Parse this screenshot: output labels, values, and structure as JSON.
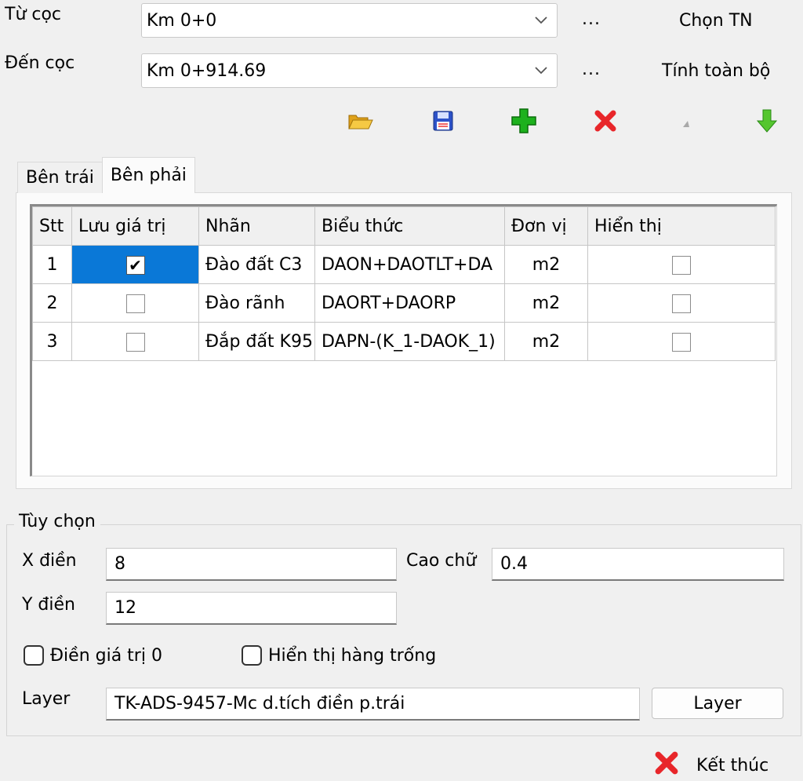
{
  "from_station": {
    "label": "Từ cọc",
    "value": "Km 0+0",
    "more": "...",
    "action": "Chọn TN"
  },
  "to_station": {
    "label": "Đến cọc",
    "value": "Km 0+914.69",
    "more": "...",
    "action": "Tính toàn bộ"
  },
  "toolbar": {
    "icons": [
      "open-folder-icon",
      "save-icon",
      "add-icon",
      "delete-icon",
      "move-up-icon",
      "move-down-icon"
    ]
  },
  "tabs": {
    "left": "Bên trái",
    "right": "Bên phải",
    "active": "right"
  },
  "table": {
    "headers": {
      "stt": "Stt",
      "save": "Lưu giá trị",
      "label": "Nhãn",
      "expr": "Biểu thức",
      "unit": "Đơn vị",
      "display": "Hiển thị"
    },
    "rows": [
      {
        "stt": "1",
        "save": true,
        "label": "Đào đất C3",
        "expr": "DAON+DAOTLT+DA",
        "unit": "m2",
        "display": false
      },
      {
        "stt": "2",
        "save": false,
        "label": "Đào rãnh",
        "expr": "DAORT+DAORP",
        "unit": "m2",
        "display": false
      },
      {
        "stt": "3",
        "save": false,
        "label": "Đắp đất K95",
        "expr": "DAPN-(K_1-DAOK_1)",
        "unit": "m2",
        "display": false
      }
    ]
  },
  "options": {
    "title": "Tùy chọn",
    "x_label": "X điền",
    "x_value": "8",
    "y_label": "Y điền",
    "y_value": "12",
    "height_label": "Cao chữ",
    "height_value": "0.4",
    "fill_zero_label": "Điền giá trị 0",
    "fill_zero": false,
    "show_empty_label": "Hiển thị hàng trống",
    "show_empty": false,
    "layer_label": "Layer",
    "layer_value": "TK-ADS-9457-Mc d.tích điền p.trái",
    "layer_button": "Layer"
  },
  "footer": {
    "finish_label": "Kết thúc"
  },
  "colors": {
    "selection": "#0a78d7",
    "add": "#1db11d",
    "delete": "#e8262a",
    "down": "#55c62f",
    "save": "#2d52c8",
    "folder": "#f2b731"
  }
}
